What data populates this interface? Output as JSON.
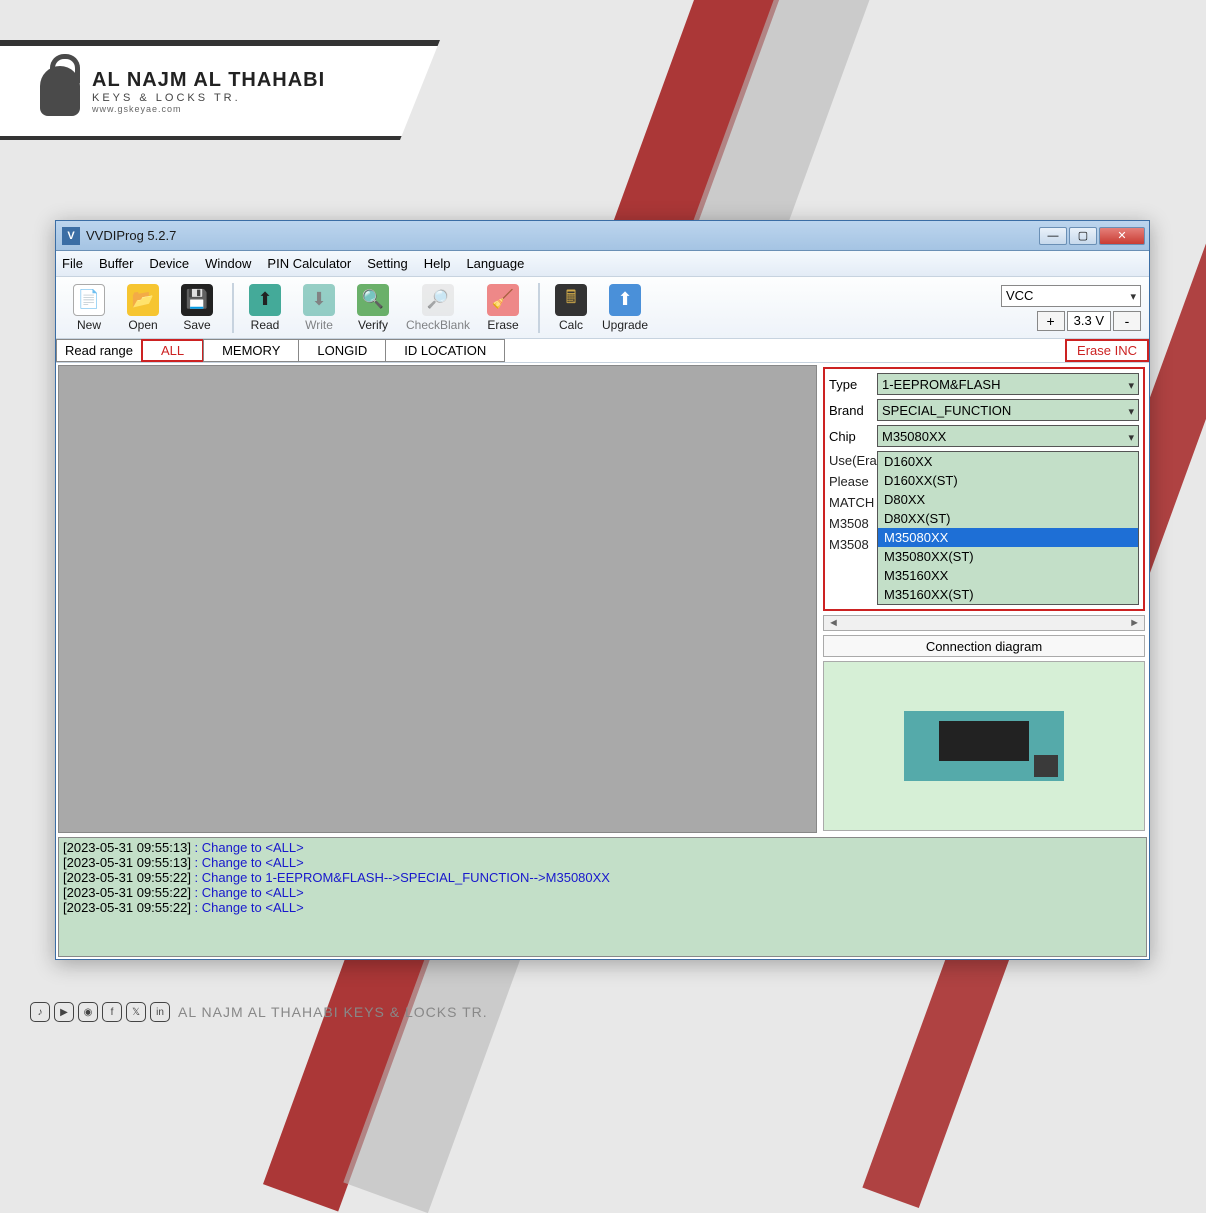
{
  "brand": {
    "title": "AL NAJM AL THAHABI",
    "subtitle": "KEYS & LOCKS TR.",
    "website": "www.gskeyae.com"
  },
  "window": {
    "title": "VVDIProg 5.2.7"
  },
  "menu": {
    "file": "File",
    "buffer": "Buffer",
    "device": "Device",
    "window": "Window",
    "pin": "PIN Calculator",
    "setting": "Setting",
    "help": "Help",
    "language": "Language"
  },
  "toolbar": {
    "new": "New",
    "open": "Open",
    "save": "Save",
    "read": "Read",
    "write": "Write",
    "verify": "Verify",
    "checkblank": "CheckBlank",
    "erase": "Erase",
    "calc": "Calc",
    "upgrade": "Upgrade"
  },
  "power": {
    "vcc": "VCC",
    "voltage": "3.3 V",
    "plus": "+",
    "minus": "-"
  },
  "range": {
    "label": "Read range",
    "all": "ALL",
    "memory": "MEMORY",
    "longid": "LONGID",
    "idloc": "ID LOCATION",
    "erase_inc": "Erase INC"
  },
  "selectors": {
    "type_label": "Type",
    "type_value": "1-EEPROM&FLASH",
    "brand_label": "Brand",
    "brand_value": "SPECIAL_FUNCTION",
    "chip_label": "Chip",
    "chip_value": "M35080XX",
    "chip_options": [
      "D160XX",
      "D160XX(ST)",
      "D80XX",
      "D80XX(ST)",
      "M35080XX",
      "M35080XX(ST)",
      "M35160XX",
      "M35160XX(ST)"
    ],
    "hint1": "Use(Era",
    "hint2": "Please",
    "hint3": "MATCH",
    "hint4": "M3508",
    "hint5": "M3508"
  },
  "conn": {
    "label": "Connection diagram"
  },
  "log": [
    {
      "ts": "[2023-05-31 09:55:13]",
      "msg": " : Change to <ALL>"
    },
    {
      "ts": "[2023-05-31 09:55:13]",
      "msg": " : Change to <ALL>"
    },
    {
      "ts": "[2023-05-31 09:55:22]",
      "msg": " : Change to 1-EEPROM&FLASH-->SPECIAL_FUNCTION-->M35080XX"
    },
    {
      "ts": "[2023-05-31 09:55:22]",
      "msg": " : Change to <ALL>"
    },
    {
      "ts": "[2023-05-31 09:55:22]",
      "msg": " : Change to <ALL>"
    }
  ],
  "footer": {
    "text": "AL NAJM AL THAHABI KEYS & LOCKS TR."
  }
}
